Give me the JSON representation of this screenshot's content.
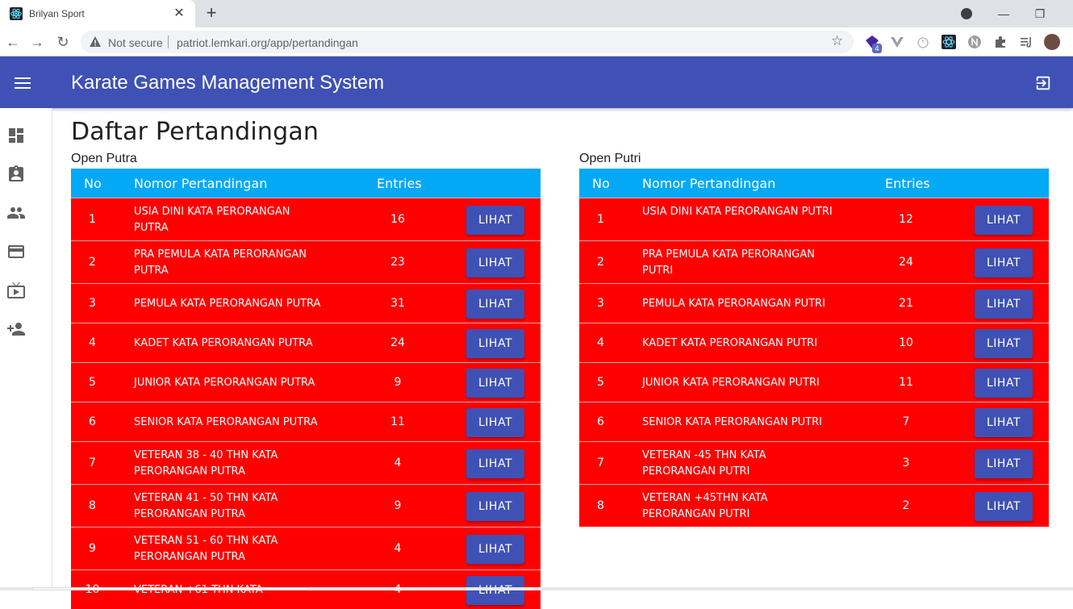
{
  "browser": {
    "tab_title": "Brilyan Sport",
    "close_glyph": "✕",
    "newtab_glyph": "+",
    "not_secure": "Not secure",
    "url": "patriot.lemkari.org/app/pertandingan",
    "extension_badge": "4",
    "minimize_glyph": "—",
    "maximize_glyph": "❐",
    "back_glyph": "←",
    "forward_glyph": "→",
    "reload_glyph": "↻",
    "star_glyph": "☆"
  },
  "app": {
    "title": "Karate Games Management System",
    "accent_color": "#3f51b5",
    "header_color": "#03a9f4",
    "row_color": "#ff0000"
  },
  "sidebar": {
    "icons": [
      "dashboard-icon",
      "assignment-ind-icon",
      "people-icon",
      "credit-card-icon",
      "live-tv-icon",
      "group-add-icon"
    ]
  },
  "page": {
    "title": "Daftar Pertandingan"
  },
  "table_headers": {
    "no": "No",
    "nomor": "Nomor Pertandingan",
    "entries": "Entries"
  },
  "putra": {
    "section_title": "Open Putra",
    "rows": [
      {
        "no": "1",
        "name": "USIA DINI KATA PERORANGAN PUTRA",
        "entries": "16",
        "action": "LIHAT"
      },
      {
        "no": "2",
        "name": "PRA PEMULA KATA PERORANGAN PUTRA",
        "entries": "23",
        "action": "LIHAT"
      },
      {
        "no": "3",
        "name": "PEMULA KATA PERORANGAN PUTRA",
        "entries": "31",
        "action": "LIHAT"
      },
      {
        "no": "4",
        "name": "KADET KATA PERORANGAN PUTRA",
        "entries": "24",
        "action": "LIHAT"
      },
      {
        "no": "5",
        "name": "JUNIOR KATA PERORANGAN PUTRA",
        "entries": "9",
        "action": "LIHAT"
      },
      {
        "no": "6",
        "name": "SENIOR KATA PERORANGAN PUTRA",
        "entries": "11",
        "action": "LIHAT"
      },
      {
        "no": "7",
        "name": "VETERAN 38 - 40 THN KATA PERORANGAN PUTRA",
        "entries": "4",
        "action": "LIHAT"
      },
      {
        "no": "8",
        "name": "VETERAN 41 - 50 THN KATA PERORANGAN PUTRA",
        "entries": "9",
        "action": "LIHAT"
      },
      {
        "no": "9",
        "name": "VETERAN 51 - 60 THN KATA PERORANGAN PUTRA",
        "entries": "4",
        "action": "LIHAT"
      },
      {
        "no": "10",
        "name": "VETERAN +61 THN KATA",
        "entries": "4",
        "action": "LIHAT"
      }
    ]
  },
  "putri": {
    "section_title": "Open Putri",
    "rows": [
      {
        "no": "1",
        "name": "USIA DINI KATA PERORANGAN PUTRI",
        "entries": "12",
        "action": "LIHAT"
      },
      {
        "no": "2",
        "name": "PRA PEMULA KATA PERORANGAN PUTRI",
        "entries": "24",
        "action": "LIHAT"
      },
      {
        "no": "3",
        "name": "PEMULA KATA PERORANGAN PUTRI",
        "entries": "21",
        "action": "LIHAT"
      },
      {
        "no": "4",
        "name": "KADET KATA PERORANGAN PUTRI",
        "entries": "10",
        "action": "LIHAT"
      },
      {
        "no": "5",
        "name": "JUNIOR KATA PERORANGAN PUTRI",
        "entries": "11",
        "action": "LIHAT"
      },
      {
        "no": "6",
        "name": "SENIOR KATA PERORANGAN PUTRI",
        "entries": "7",
        "action": "LIHAT"
      },
      {
        "no": "7",
        "name": "VETERAN -45 THN KATA PERORANGAN PUTRI",
        "entries": "3",
        "action": "LIHAT"
      },
      {
        "no": "8",
        "name": "VETERAN +45THN KATA PERORANGAN PUTRI",
        "entries": "2",
        "action": "LIHAT"
      }
    ]
  }
}
